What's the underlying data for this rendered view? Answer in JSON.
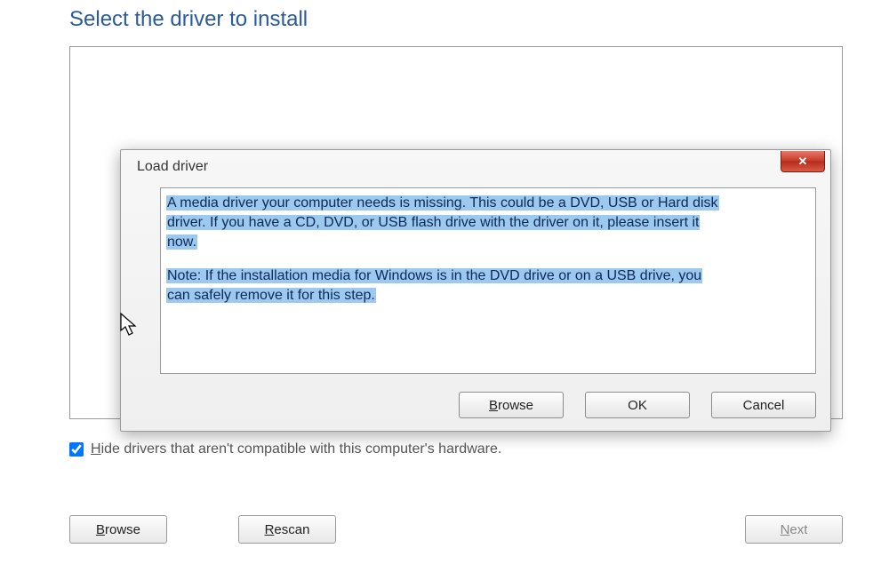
{
  "main": {
    "title": "Select the driver to install",
    "checkbox_label_prefix": "H",
    "checkbox_label_rest": "ide drivers that aren't compatible with this computer's hardware.",
    "browse_u": "B",
    "browse_rest": "rowse",
    "rescan_u": "R",
    "rescan_rest": "escan",
    "next_u": "N",
    "next_rest": "ext"
  },
  "dialog": {
    "title": "Load driver",
    "msg1a": "A media driver your computer needs is missing. This could be a DVD, USB or Hard disk",
    "msg1b": "driver. If you have a CD, DVD, or USB flash drive with the driver on it, please insert it",
    "msg1c": "now.",
    "msg2a": "Note: If the installation media for Windows is in the DVD drive or on a USB drive, you",
    "msg2b": "can safely remove it for this step.",
    "browse_u": "B",
    "browse_rest": "rowse",
    "ok": "OK",
    "cancel": "Cancel"
  }
}
